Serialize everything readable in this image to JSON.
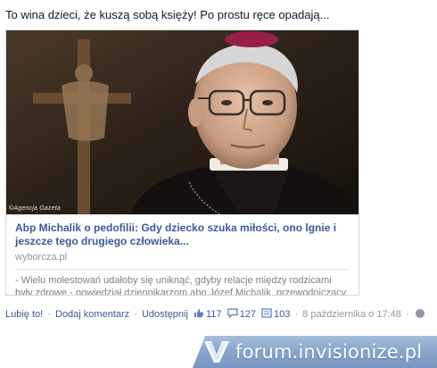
{
  "post": {
    "text": "To wina dzieci, że kuszą sobą księży! Po prostu ręce opadają..."
  },
  "share": {
    "image_credit": "©Agencja Gazeta",
    "title": "Abp Michalik o pedofilii: Gdy dziecko szuka miłości, ono lgnie i jeszcze tego drugiego człowieka...",
    "source": "wyborcza.pl",
    "description": "- Wielu molestowań udałoby się uniknąć, gdyby relacje między rodzicami były zdrowe - powiedział dziennikarzom abp Józef Michalik, przewodniczący"
  },
  "actions": {
    "like_label": "Lubię to!",
    "comment_label": "Dodaj komentarz",
    "share_label": "Udostępnij",
    "separator": "·",
    "likes_count": "117",
    "comments_count": "127",
    "shares_count": "103",
    "timestamp": "8 października o 17:48",
    "like_icon": "thumbs-up-icon",
    "comment_icon": "speech-bubble-icon",
    "share_icon": "share-icon",
    "audience_icon": "globe-icon"
  },
  "watermark": {
    "text": "forum.invisionize.pl",
    "icon": "v-logo-icon"
  },
  "colors": {
    "link": "#3b5998",
    "meta": "#9197a3",
    "text": "#141823",
    "border": "#d3d6db"
  }
}
